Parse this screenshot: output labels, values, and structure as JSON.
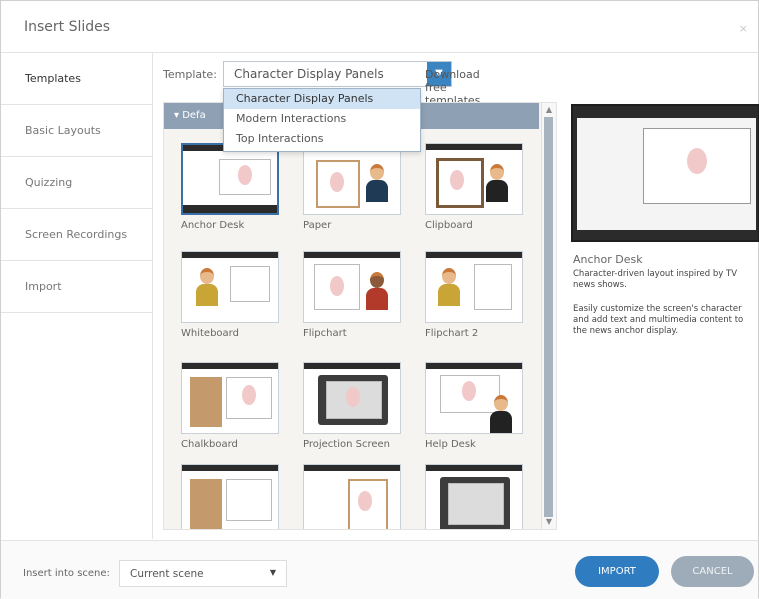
{
  "dialog": {
    "title": "Insert Slides",
    "close_glyph": "×"
  },
  "sidebar": {
    "items": [
      {
        "label": "Templates"
      },
      {
        "label": "Basic Layouts"
      },
      {
        "label": "Quizzing"
      },
      {
        "label": "Screen Recordings"
      },
      {
        "label": "Import"
      }
    ]
  },
  "template_picker": {
    "label": "Template:",
    "selected": "Character Display Panels",
    "download_link": "Download free templates",
    "options": [
      "Character Display Panels",
      "Modern Interactions",
      "Top Interactions"
    ]
  },
  "gallery": {
    "group_header": "▾ Defa",
    "tiles": [
      {
        "label": "Anchor Desk"
      },
      {
        "label": "Paper"
      },
      {
        "label": "Clipboard"
      },
      {
        "label": "Whiteboard"
      },
      {
        "label": "Flipchart"
      },
      {
        "label": "Flipchart 2"
      },
      {
        "label": "Chalkboard"
      },
      {
        "label": "Projection Screen"
      },
      {
        "label": "Help Desk"
      },
      {
        "label": ""
      },
      {
        "label": ""
      },
      {
        "label": ""
      }
    ]
  },
  "preview": {
    "title": "Anchor Desk",
    "description": "Character-driven layout inspired by TV news shows.",
    "detail": "Easily customize the screen's character and add text and multimedia content to the news anchor display."
  },
  "footer": {
    "insert_label": "Insert into scene:",
    "scene_value": "Current scene",
    "import_label": "IMPORT",
    "cancel_label": "CANCEL"
  },
  "colors": {
    "accent": "#2f7cc1",
    "cancel": "#9eacb9",
    "selected_option": "#cfe3f5"
  }
}
